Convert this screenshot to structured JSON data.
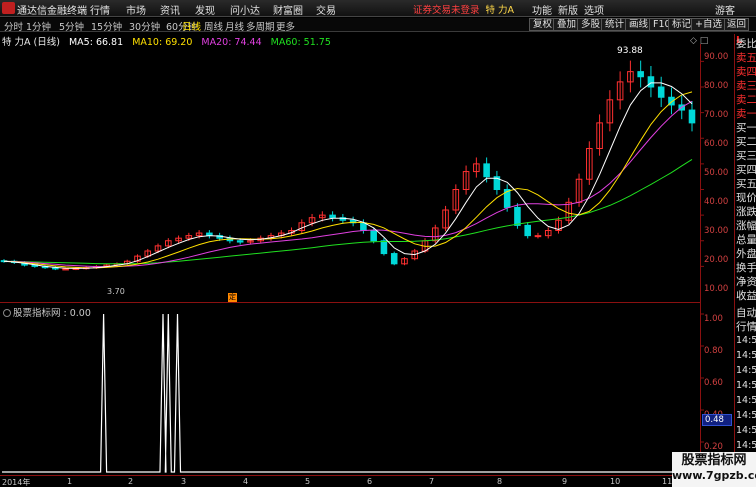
{
  "menubar": {
    "app_title": "通达信金融终端",
    "menus": [
      "行情",
      "市场",
      "资讯",
      "发现",
      "问小达",
      "财富圈",
      "交易"
    ],
    "status_text": "证券交易未登录",
    "stock_name": "特 力A",
    "right_items": [
      "功能",
      "新版",
      "选项",
      "游客"
    ]
  },
  "periodbar": {
    "periods": [
      "分时",
      "1分钟",
      "5分钟",
      "15分钟",
      "30分钟",
      "60分钟",
      "日线",
      "周线",
      "月线",
      "多周期",
      "更多"
    ],
    "active_period": "日线",
    "tools": [
      "复权",
      "叠加",
      "多股",
      "统计",
      "画线",
      "F10",
      "标记",
      "+自选",
      "返回"
    ]
  },
  "chart_title": {
    "name": "特 力A (日线)",
    "ma5": "MA5: 66.81",
    "ma10": "MA10: 69.20",
    "ma20": "MA20: 74.44",
    "ma60": "MA60: 51.75"
  },
  "colors": {
    "ma5": "#ffffff",
    "ma10": "#ffe000",
    "ma20": "#e040e0",
    "ma60": "#20e020",
    "up_candle": "#ff3030",
    "down_candle": "#00d8d8",
    "axis_text": "#d04040"
  },
  "price_axis": [
    "90.00",
    "80.00",
    "70.00",
    "60.00",
    "50.00",
    "40.00",
    "30.00",
    "20.00",
    "10.00"
  ],
  "max_label": "93.88",
  "min_label": "3.70",
  "marker_text": "定",
  "sub_chart": {
    "label": "股票指标网 : 0.00",
    "axis": [
      "1.00",
      "0.80",
      "0.60",
      "0.40",
      "0.20"
    ],
    "current_value": "0.48"
  },
  "x_axis": {
    "year_label": "2014年",
    "months": [
      "1",
      "2",
      "3",
      "4",
      "5",
      "6",
      "7",
      "8",
      "9",
      "10",
      "11"
    ]
  },
  "right_panel": {
    "badge": "L",
    "items": [
      "委比",
      "卖五",
      "卖四",
      "卖三",
      "卖二",
      "卖一",
      "买一",
      "买二",
      "买三",
      "买四",
      "买五",
      "现价",
      "涨跌",
      "涨幅",
      "总量",
      "外盘",
      "换手",
      "净资",
      "收益",
      "自动",
      "行情"
    ],
    "times": [
      "14:50",
      "14:50",
      "14:50",
      "14:50",
      "14:50",
      "14:50",
      "14:50",
      "14:50"
    ]
  },
  "watermark": {
    "line1": "股票指标网",
    "line2": "www.7gpzb.com"
  },
  "chart_data": {
    "type": "candlestick",
    "title": "特 力A (日线)",
    "ylim": [
      0,
      96
    ],
    "y_ticks": [
      10,
      20,
      30,
      40,
      50,
      60,
      70,
      80,
      90
    ],
    "months": [
      "1",
      "2",
      "3",
      "4",
      "5",
      "6",
      "7",
      "8",
      "9",
      "10",
      "11"
    ],
    "max": 93.88,
    "min": 3.7,
    "close_series": [
      12,
      11.5,
      10.5,
      10,
      9.5,
      9,
      9,
      9.2,
      9.5,
      10,
      10.5,
      11,
      12,
      14,
      16,
      18,
      20,
      21,
      22,
      23,
      22,
      21,
      20,
      19.5,
      20,
      21,
      22,
      23,
      24,
      27,
      29,
      30,
      29,
      28,
      27,
      24,
      20,
      15,
      11,
      13,
      16,
      20,
      25,
      32,
      40,
      47,
      50,
      45,
      40,
      33,
      26,
      22,
      22,
      24,
      28,
      35,
      44,
      56,
      66,
      75,
      82,
      86,
      84,
      80,
      76,
      73,
      71,
      66
    ],
    "ma5_series": [
      12,
      11.7,
      11.2,
      10.6,
      10,
      9.6,
      9.3,
      9.2,
      9.3,
      9.5,
      9.9,
      10.4,
      11,
      12.2,
      13.8,
      15.6,
      17.4,
      19,
      20.5,
      21.6,
      22,
      21.8,
      21.2,
      20.6,
      20.4,
      20.6,
      21.2,
      22,
      23.2,
      25,
      26.6,
      28,
      28.8,
      28.8,
      28.4,
      27.2,
      25,
      21.4,
      17.2,
      15,
      14.6,
      16,
      18.6,
      23,
      28.6,
      35,
      41,
      44.4,
      44.4,
      42.8,
      38.8,
      33.4,
      28.8,
      25.6,
      24.4,
      26.2,
      30.6,
      37.4,
      45.8,
      55.2,
      64.6,
      73,
      78.6,
      81.6,
      81.6,
      80.2,
      77.4,
      73.4
    ],
    "ma10_series": [
      12,
      11.8,
      11.4,
      11,
      10.6,
      10.2,
      9.8,
      9.6,
      9.4,
      9.4,
      9.6,
      9.9,
      10.3,
      10.9,
      11.7,
      12.8,
      14.2,
      15.6,
      17.1,
      18.5,
      19.6,
      20.3,
      20.7,
      20.8,
      20.7,
      20.6,
      20.8,
      21.2,
      21.9,
      22.8,
      23.8,
      25,
      26,
      26.8,
      27.2,
      27.1,
      26.4,
      25,
      22.8,
      20.7,
      18.8,
      17.8,
      17.9,
      19.3,
      21.8,
      25.2,
      29.2,
      33.3,
      36.8,
      39.2,
      40.4,
      39.9,
      37.9,
      35.2,
      32.6,
      30.7,
      30.1,
      31.5,
      34.9,
      39.8,
      45.8,
      52.6,
      59.2,
      65.4,
      70.4,
      74.2,
      76.9,
      78.1
    ],
    "ma20_series": [
      12,
      11.9,
      11.7,
      11.4,
      11.1,
      10.8,
      10.5,
      10.3,
      10.1,
      9.9,
      9.9,
      9.9,
      10.1,
      10.3,
      10.7,
      11.2,
      11.9,
      12.7,
      13.6,
      14.6,
      15.6,
      16.5,
      17.4,
      18.1,
      18.7,
      19.1,
      19.5,
      19.9,
      20.3,
      20.7,
      21.2,
      21.8,
      22.4,
      23,
      23.6,
      24,
      24.2,
      24.1,
      23.6,
      22.9,
      22.2,
      21.7,
      21.6,
      22.1,
      23.2,
      24.8,
      26.7,
      28.9,
      31,
      32.8,
      33.9,
      34.4,
      34.4,
      34.2,
      34,
      34.2,
      35,
      36.6,
      39.1,
      42.4,
      46.3,
      50.8,
      55.6,
      60.3,
      64.7,
      68.7,
      72.1,
      74.4
    ],
    "ma60_series": [
      12,
      11.9,
      11.8,
      11.7,
      11.6,
      11.5,
      11.4,
      11.3,
      11.2,
      11.1,
      11,
      11,
      11,
      11.1,
      11.2,
      11.4,
      11.7,
      12,
      12.4,
      12.8,
      13.2,
      13.6,
      14,
      14.4,
      14.8,
      15.2,
      15.6,
      16,
      16.4,
      16.8,
      17.3,
      17.8,
      18.3,
      18.7,
      19.1,
      19.4,
      19.6,
      19.7,
      19.7,
      19.7,
      19.8,
      20,
      20.3,
      20.8,
      21.5,
      22.3,
      23.2,
      24.1,
      25,
      25.8,
      26.5,
      27.1,
      27.6,
      28.1,
      28.6,
      29.2,
      30,
      31,
      32.3,
      33.8,
      35.6,
      37.6,
      39.8,
      42,
      44.3,
      46.6,
      49.2,
      51.75
    ],
    "indicator": {
      "name": "股票指标网",
      "value": 0.0,
      "spikes_month_position": [
        1.6,
        2.5,
        2.58,
        2.72
      ],
      "spike_value": 1.0
    }
  }
}
